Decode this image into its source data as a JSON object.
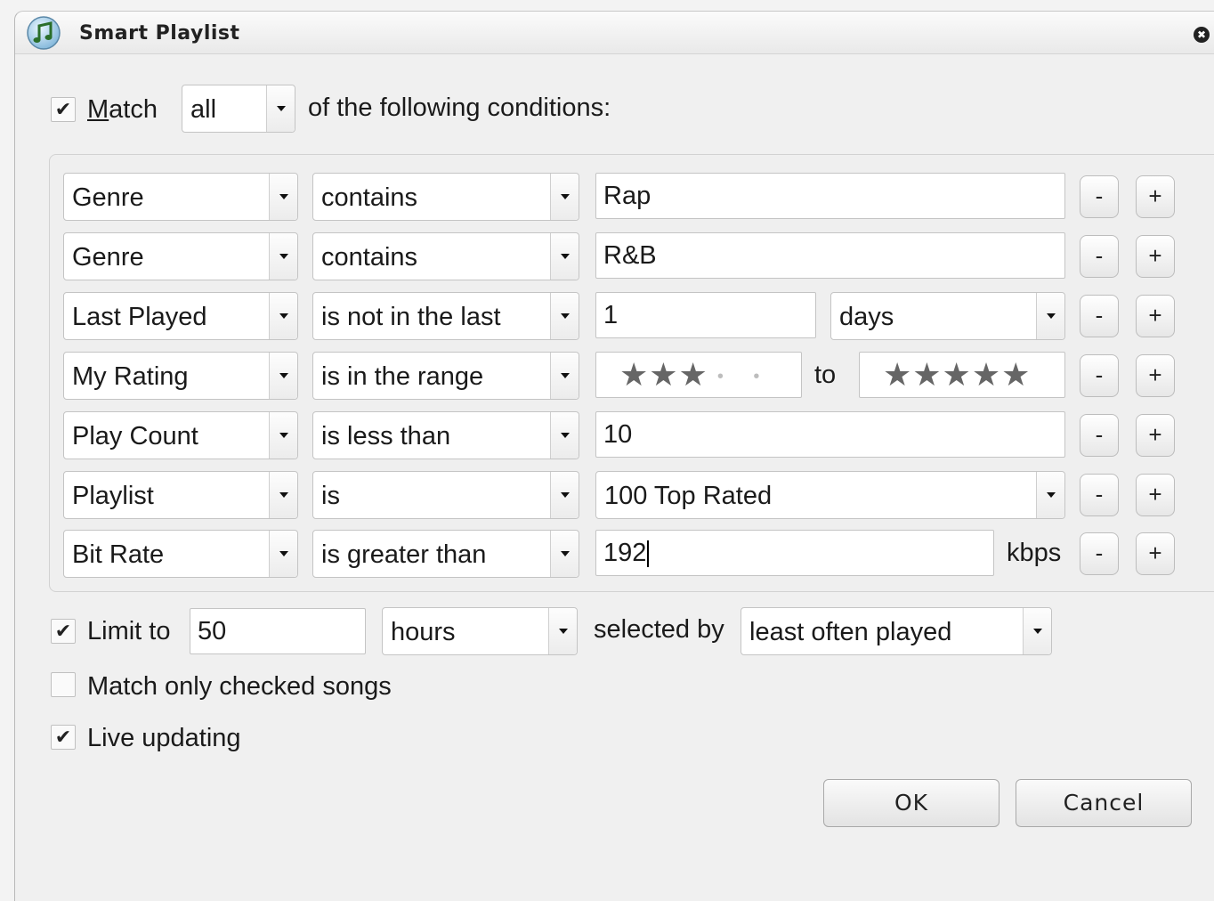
{
  "window": {
    "title": "Smart Playlist",
    "close_glyph": "✖"
  },
  "match": {
    "checked": "✔",
    "label": "Match",
    "mode": "all",
    "suffix": "of the following conditions:"
  },
  "rules": [
    {
      "field": "Genre",
      "operator": "contains",
      "value": "Rap"
    },
    {
      "field": "Genre",
      "operator": "contains",
      "value": "R&B"
    },
    {
      "field": "Last Played",
      "operator": "is not in the last",
      "value": "1",
      "unit": "days"
    },
    {
      "field": "My Rating",
      "operator": "is in the range",
      "rating_from": 3,
      "rating_to": 5,
      "rating_from_stars": "★★★",
      "rating_from_empty": "• •",
      "range_to_label": "to",
      "rating_to_stars": "★★★★★"
    },
    {
      "field": "Play Count",
      "operator": "is less than",
      "value": "10"
    },
    {
      "field": "Playlist",
      "operator": "is",
      "value": "100 Top Rated"
    },
    {
      "field": "Bit Rate",
      "operator": "is greater than",
      "value": "192",
      "unit_label": "kbps"
    }
  ],
  "rule_buttons": {
    "remove": "-",
    "add": "+"
  },
  "limit": {
    "checked": "✔",
    "label": "Limit to",
    "value": "50",
    "unit": "hours",
    "selected_by_label": "selected by",
    "selected_by": "least often played"
  },
  "options": {
    "match_checked": {
      "checked": "",
      "label": "Match only checked songs"
    },
    "live_updating": {
      "checked": "✔",
      "label": "Live updating"
    }
  },
  "buttons": {
    "ok": "OK",
    "cancel": "Cancel"
  }
}
